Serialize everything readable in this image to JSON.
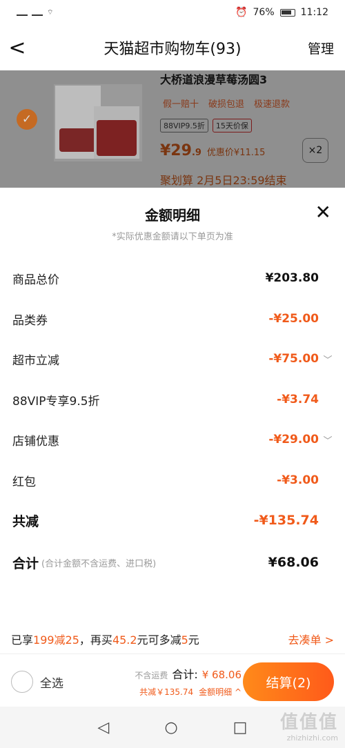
{
  "status": {
    "battery": "76%",
    "time": "11:12"
  },
  "nav": {
    "back": "<",
    "title": "天猫超市购物车(93)",
    "manage": "管理"
  },
  "product": {
    "title": "大桥道浪漫草莓汤圆3",
    "tags": [
      "假一赔十",
      "破损包退",
      "极速退款"
    ],
    "badge_vip": "88VIP9.5折",
    "badge_price": "15天价保",
    "price_main": "¥29",
    "price_dec": ".9",
    "discount": "优惠价¥11.15",
    "qty": "×2",
    "promo": "聚划算 2月5日23:59结束"
  },
  "sheet": {
    "title": "金额明细",
    "close": "✕",
    "subtitle": "*实际优惠金额请以下单页为准",
    "rows": [
      {
        "label": "商品总价",
        "value": "¥203.80"
      },
      {
        "label": "品类券",
        "value": "-¥25.00"
      },
      {
        "label": "超市立减",
        "value": "-¥75.00"
      },
      {
        "label": "88VIP专享9.5折",
        "value": "-¥3.74"
      },
      {
        "label": "店铺优惠",
        "value": "-¥29.00"
      },
      {
        "label": "红包",
        "value": "-¥3.00"
      }
    ],
    "total_reduce": {
      "label": "共减",
      "value": "-¥135.74"
    },
    "sum": {
      "label": "合计",
      "note": "(合计金额不含运费、进口税)",
      "value": "¥68.06"
    }
  },
  "tip": {
    "p1": "已享",
    "h1": "199减25",
    "p2": "，再买",
    "h2": "45.2",
    "p3": "元可多减",
    "h3": "5",
    "p4": "元",
    "link": "去凑单 >"
  },
  "footer": {
    "select_all": "全选",
    "no_shipping": "不含运费",
    "total_label": "合计:",
    "total": "¥ 68.06",
    "reduce": "共减￥135.74",
    "detail": "金额明细 ^",
    "checkout": "结算(2)"
  },
  "sysnav": {
    "back": "◁",
    "home": "○",
    "recent": "□"
  },
  "watermark": {
    "big": "值值值",
    "small": "zhizhizhi.com"
  }
}
